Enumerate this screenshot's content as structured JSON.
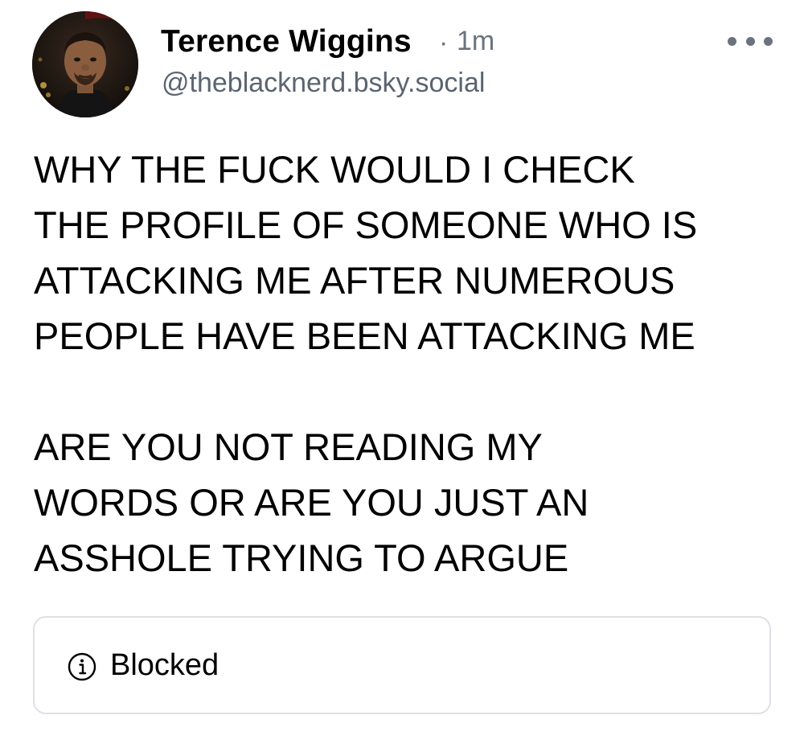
{
  "post": {
    "author": {
      "display_name": "Terence Wiggins",
      "handle": "@theblacknerd.bsky.social",
      "avatar": "profile-photo"
    },
    "separator": "·",
    "timestamp": "1m",
    "more_icon": "more-horizontal-icon",
    "paragraphs": [
      "WHY THE FUCK WOULD I CHECK\nTHE PROFILE OF SOMEONE WHO IS\nATTACKING ME AFTER NUMEROUS\nPEOPLE HAVE BEEN ATTACKING ME",
      "ARE YOU NOT READING MY\nWORDS OR ARE YOU JUST AN\nASSHOLE TRYING TO ARGUE"
    ],
    "embed": {
      "icon": "info-icon",
      "label": "Blocked"
    }
  },
  "colors": {
    "text": "#000000",
    "muted": "#6b7280",
    "border": "#dde1e6"
  }
}
